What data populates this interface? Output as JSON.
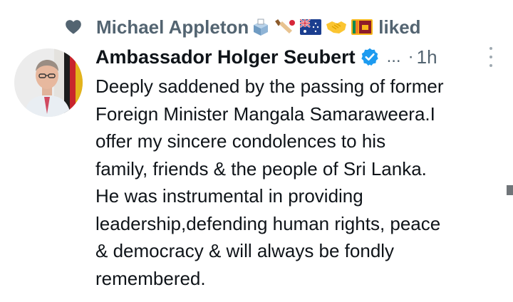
{
  "social_context": {
    "icon": "heart-icon",
    "user": "Michael Appleton",
    "emojis": [
      "ballot-box-icon",
      "cricket-bat-icon",
      "australia-flag-icon",
      "handshake-icon",
      "sri-lanka-flag-icon"
    ],
    "action": "liked"
  },
  "tweet": {
    "author_name": "Ambassador Holger Seubert",
    "verified": true,
    "handle": "...",
    "separator": "·",
    "time": "1h",
    "text_lines": [
      "Deeply saddened by the passing of former",
      "Foreign Minister Mangala Samaraweera.I",
      "offer my sincere condolences to his",
      "family, friends & the people of Sri Lanka.",
      "He was instrumental in providing",
      "leadership,defending human rights, peace",
      "& democracy & will always be fondly",
      "remembered."
    ]
  },
  "colors": {
    "primary_text": "#0f1419",
    "secondary_text": "#536471",
    "verified_blue": "#1d9bf0",
    "background": "#ffffff"
  }
}
